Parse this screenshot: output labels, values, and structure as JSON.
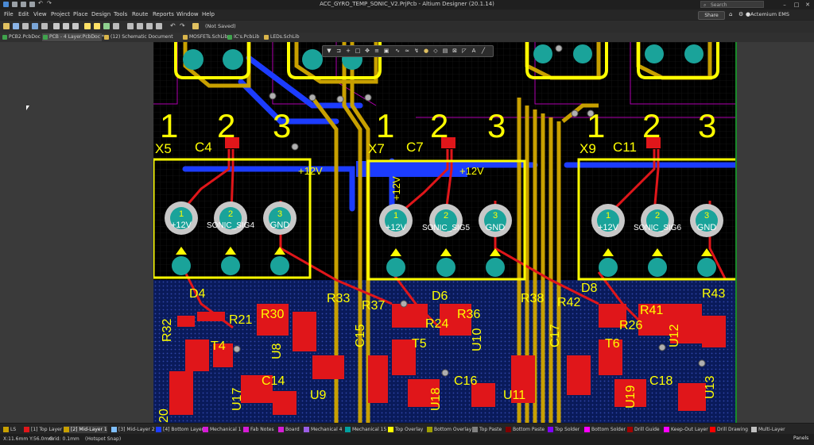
{
  "window": {
    "title": "ACC_GYRO_TEMP_SONIC_V2.PrjPcb - Altium Designer (20.1.14)",
    "search_placeholder": "Search",
    "minimize": "–",
    "maximize": "□",
    "close": "✕"
  },
  "menu": [
    "File",
    "Edit",
    "View",
    "Project",
    "Place",
    "Design",
    "Tools",
    "Route",
    "Reports",
    "Window",
    "Help"
  ],
  "menubar": {
    "share_label": "Share",
    "account_label": "Actemium EMS"
  },
  "toolbar": {
    "save_state": "(Not Saved)"
  },
  "tabs": [
    {
      "label": "PCB2.PcbDoc",
      "icon_color": "#3fa34d",
      "active": false
    },
    {
      "label": "PCB - 4 Layer.PcbDoc *",
      "icon_color": "#3fa34d",
      "active": true
    },
    {
      "label": "(12) Schematic Document",
      "icon_color": "#d9b44a",
      "active": false
    },
    {
      "label": "MOSFETs.SchLib",
      "icon_color": "#d9b44a",
      "active": false
    },
    {
      "label": "IC's.PcbLib",
      "icon_color": "#3fa34d",
      "active": false
    },
    {
      "label": "LEDs.SchLib",
      "icon_color": "#d9b44a",
      "active": false
    }
  ],
  "pcb": {
    "connectors": [
      {
        "designator": "X5",
        "cap": "C4",
        "net": "SONIC_SIG4",
        "rail": "+12V"
      },
      {
        "designator": "X7",
        "cap": "C7",
        "net": "SONIC_SIG5",
        "rail": "+12V"
      },
      {
        "designator": "X9",
        "cap": "C11",
        "net": "SONIC_SIG6",
        "rail": "+12V"
      }
    ],
    "pin_numbers": [
      "1",
      "2",
      "3"
    ],
    "pin_nets": [
      "+12V",
      "GND"
    ],
    "designators": [
      "D4",
      "R32",
      "R21",
      "R30",
      "R33",
      "U8",
      "T4",
      "U17",
      "C14",
      "U9",
      "C15",
      "R37",
      "D6",
      "R36",
      "R24",
      "U10",
      "T5",
      "U18",
      "C16",
      "U11",
      "R38",
      "C17",
      "R42",
      "D8",
      "R41",
      "R43",
      "R26",
      "U12",
      "T6",
      "U19",
      "C18",
      "U13",
      "20"
    ]
  },
  "layers": [
    {
      "label": "LS",
      "color": "#c8a000",
      "active": false
    },
    {
      "label": "[1] Top Layer",
      "color": "#e0161a",
      "active": false
    },
    {
      "label": "[2] Mid-Layer 1",
      "color": "#c8a000",
      "active": true
    },
    {
      "label": "[3] Mid-Layer 2",
      "color": "#7fbfff",
      "active": false
    },
    {
      "label": "[4] Bottom Layer",
      "color": "#1c3cff",
      "active": false
    },
    {
      "label": "Mechanical 1",
      "color": "#d51cd5",
      "active": false
    },
    {
      "label": "Fab Notes",
      "color": "#d51cd5",
      "active": false
    },
    {
      "label": "Board",
      "color": "#d51cd5",
      "active": false
    },
    {
      "label": "Mechanical 4",
      "color": "#9b5de5",
      "active": false
    },
    {
      "label": "Mechanical 15",
      "color": "#00a0a0",
      "active": false
    },
    {
      "label": "Top Overlay",
      "color": "#ffff00",
      "active": false
    },
    {
      "label": "Bottom Overlay",
      "color": "#a0a000",
      "active": false
    },
    {
      "label": "Top Paste",
      "color": "#808080",
      "active": false
    },
    {
      "label": "Bottom Paste",
      "color": "#800000",
      "active": false
    },
    {
      "label": "Top Solder",
      "color": "#8000ff",
      "active": false
    },
    {
      "label": "Bottom Solder",
      "color": "#ff00ff",
      "active": false
    },
    {
      "label": "Drill Guide",
      "color": "#a00000",
      "active": false
    },
    {
      "label": "Keep-Out Layer",
      "color": "#ff00ff",
      "active": false
    },
    {
      "label": "Drill Drawing",
      "color": "#ff0000",
      "active": false
    },
    {
      "label": "Multi-Layer",
      "color": "#c0c0c0",
      "active": false
    }
  ],
  "status": {
    "coords": "X:11.6mm Y:56.0mm",
    "grid": "Grid: 0.1mm",
    "snap": "(Hotspot Snap)",
    "panels_label": "Panels"
  }
}
